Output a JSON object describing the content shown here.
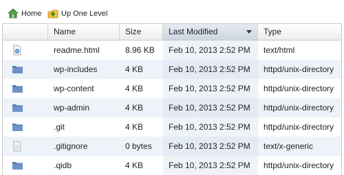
{
  "toolbar": {
    "home_label": "Home",
    "up_label": "Up One Level"
  },
  "columns": {
    "name": "Name",
    "size": "Size",
    "modified": "Last Modified",
    "type": "Type"
  },
  "colors": {
    "folder": "#5a7fb8",
    "sorted_header": "#cdd6e2",
    "alt_row": "#eef3fa"
  },
  "rows": [
    {
      "icon": "html-file-icon",
      "name": "readme.html",
      "size": "8.96 KB",
      "modified": "Feb 10, 2013 2:52 PM",
      "type": "text/html"
    },
    {
      "icon": "folder-icon",
      "name": "wp-includes",
      "size": "4 KB",
      "modified": "Feb 10, 2013 2:52 PM",
      "type": "httpd/unix-directory"
    },
    {
      "icon": "folder-icon",
      "name": "wp-content",
      "size": "4 KB",
      "modified": "Feb 10, 2013 2:52 PM",
      "type": "httpd/unix-directory"
    },
    {
      "icon": "folder-icon",
      "name": "wp-admin",
      "size": "4 KB",
      "modified": "Feb 10, 2013 2:52 PM",
      "type": "httpd/unix-directory"
    },
    {
      "icon": "folder-icon",
      "name": ".git",
      "size": "4 KB",
      "modified": "Feb 10, 2013 2:52 PM",
      "type": "httpd/unix-directory"
    },
    {
      "icon": "text-file-icon",
      "name": ".gitignore",
      "size": "0 bytes",
      "modified": "Feb 10, 2013 2:52 PM",
      "type": "text/x-generic"
    },
    {
      "icon": "folder-icon",
      "name": ".qidb",
      "size": "4 KB",
      "modified": "Feb 10, 2013 2:52 PM",
      "type": "httpd/unix-directory"
    }
  ]
}
